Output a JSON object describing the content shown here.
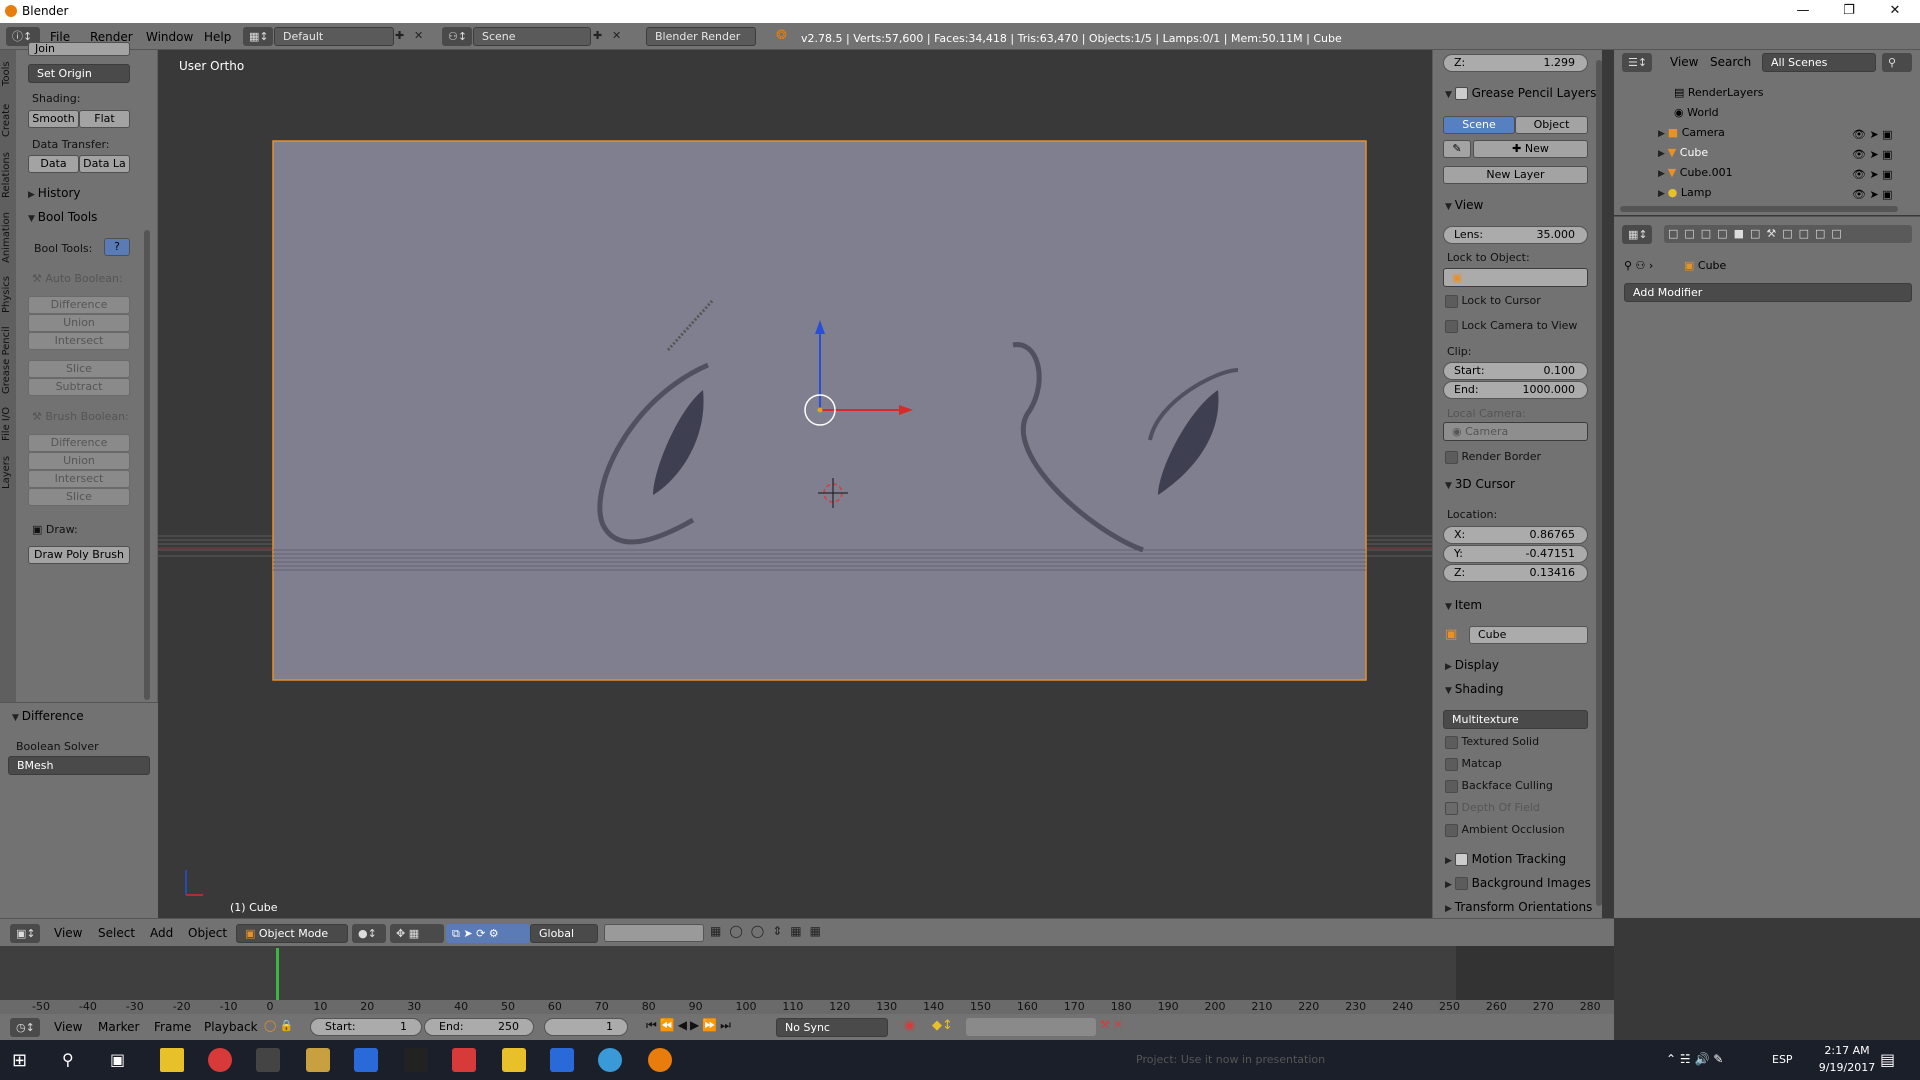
{
  "window": {
    "title": "Blender"
  },
  "menubar": {
    "items": [
      "File",
      "Render",
      "Window",
      "Help"
    ],
    "layout": "Default",
    "scene": "Scene",
    "engine": "Blender Render",
    "stats": "v2.78.5 | Verts:57,600 | Faces:34,418 | Tris:63,470 | Objects:1/5 | Lamps:0/1 | Mem:50.11M | Cube"
  },
  "left_tabs": [
    "Tools",
    "Create",
    "Relations",
    "Animation",
    "Physics",
    "Grease Pencil",
    "File I/O",
    "Layers"
  ],
  "toolshelf": {
    "join": "Join",
    "set_origin": "Set Origin",
    "shading_label": "Shading:",
    "smooth": "Smooth",
    "flat": "Flat",
    "data_transfer_label": "Data Transfer:",
    "data": "Data",
    "data_la": "Data La",
    "history": "History",
    "bool_tools": "Bool Tools",
    "bool_tools_label": "Bool Tools:",
    "help": "?",
    "auto_boolean": "Auto Boolean:",
    "auto_ops": [
      "Difference",
      "Union",
      "Intersect",
      "Slice",
      "Subtract"
    ],
    "brush_boolean": "Brush Boolean:",
    "brush_ops": [
      "Difference",
      "Union",
      "Intersect",
      "Slice"
    ],
    "draw_label": "Draw:",
    "draw_poly": "Draw Poly Brush"
  },
  "operator": {
    "title": "Difference",
    "solver_label": "Boolean Solver",
    "solver": "BMesh"
  },
  "viewport": {
    "view_name": "User Ortho",
    "object_label": "(1) Cube"
  },
  "npanel": {
    "z_label": "Z:",
    "z_value": "1.299",
    "gp_layers": "Grease Pencil Layers",
    "scene": "Scene",
    "object": "Object",
    "new": "New",
    "new_layer": "New Layer",
    "view": "View",
    "lens_label": "Lens:",
    "lens": "35.000",
    "lock_to_object": "Lock to Object:",
    "lock_to_cursor": "Lock to Cursor",
    "lock_camera": "Lock Camera to View",
    "clip": "Clip:",
    "start_label": "Start:",
    "start": "0.100",
    "end_label": "End:",
    "end": "1000.000",
    "local_camera": "Local Camera:",
    "camera": "Camera",
    "render_border": "Render Border",
    "cursor_3d": "3D Cursor",
    "location": "Location:",
    "x_label": "X:",
    "x": "0.86765",
    "y_label": "Y:",
    "y": "-0.47151",
    "z2_label": "Z:",
    "z2": "0.13416",
    "item": "Item",
    "item_name": "Cube",
    "display": "Display",
    "shading": "Shading",
    "multitexture": "Multitexture",
    "textured_solid": "Textured Solid",
    "matcap": "Matcap",
    "backface": "Backface Culling",
    "dof": "Depth Of Field",
    "ao": "Ambient Occlusion",
    "motion_tracking": "Motion Tracking",
    "background_images": "Background Images",
    "transform_orientations": "Transform Orientations"
  },
  "outliner": {
    "view": "View",
    "search": "Search",
    "scenes": "All Scenes",
    "items": [
      "RenderLayers",
      "World",
      "Camera",
      "Cube",
      "Cube.001",
      "Lamp"
    ]
  },
  "properties": {
    "object": "Cube",
    "add_modifier": "Add Modifier"
  },
  "vp_header": {
    "items": [
      "View",
      "Select",
      "Add",
      "Object"
    ],
    "mode": "Object Mode",
    "orientation": "Global"
  },
  "timeline": {
    "ticks": [
      "-50",
      "-40",
      "-30",
      "-20",
      "-10",
      "0",
      "10",
      "20",
      "30",
      "40",
      "50",
      "60",
      "70",
      "80",
      "90",
      "100",
      "110",
      "120",
      "130",
      "140",
      "150",
      "160",
      "170",
      "180",
      "190",
      "200",
      "210",
      "220",
      "230",
      "240",
      "250",
      "260",
      "270",
      "280"
    ]
  },
  "timeline_header": {
    "items": [
      "View",
      "Marker",
      "Frame",
      "Playback"
    ],
    "start_label": "Start:",
    "start": "1",
    "end_label": "End:",
    "end": "250",
    "current": "1",
    "sync": "No Sync"
  },
  "taskbar": {
    "notification": "Project: Use it now in presentation",
    "lang": "ESP",
    "time": "2:17 AM",
    "date": "9/19/2017"
  }
}
